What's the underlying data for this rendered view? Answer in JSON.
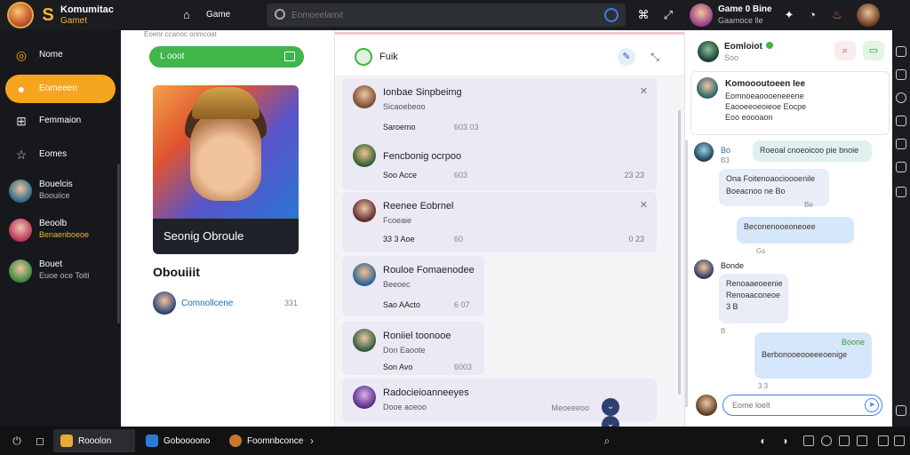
{
  "topbar": {
    "app_title": "Komumitac",
    "app_sub": "Gamet",
    "game_label": "Game",
    "search_placeholder": "Eomoeelamit",
    "profile_name": "Game 0 Bine",
    "profile_sub": "Gaamoce lle"
  },
  "sidebar": {
    "nav": [
      {
        "label": "Nome",
        "icon": "home-icon"
      },
      {
        "label": "Eomeeen",
        "icon": "friends-icon"
      },
      {
        "label": "Femmaion",
        "icon": "grid-icon"
      },
      {
        "label": "Eomes",
        "icon": "star-icon"
      }
    ],
    "contacts": [
      {
        "name": "Bouelcis",
        "sub": "Boouiice"
      },
      {
        "name": "Beoolb",
        "sub": "Benaenboeoe"
      },
      {
        "name": "Bouet",
        "sub": "Euoe oce Toiti"
      }
    ]
  },
  "game_panel": {
    "caption": "Eoenr ccanoc onmcoat",
    "green_button": "L ooot",
    "hero_title": "Seonig Obroule",
    "section_title": "Obouiiit",
    "item_label": "Comnollcene",
    "item_meta": "331"
  },
  "feed": {
    "title": "Fuik",
    "items": [
      {
        "name": "Ionbae Sinpbeimg",
        "sub": "Sicaoebeoo",
        "user": "Saroemo",
        "count": "",
        "meta": "",
        "mid": "603 03",
        "closable": true
      },
      {
        "name": "Fencbonig ocrpoo",
        "sub": "",
        "user": "Soo Acce",
        "count": "603",
        "meta": "23 23",
        "closable": false
      },
      {
        "name": "Reenee Eobrnel",
        "sub": "Fcoeaie",
        "user": "33 3 Aoe",
        "count": "60",
        "meta": "0 23",
        "closable": true
      },
      {
        "name": "Rouloe Fomaenodee",
        "sub": "Beeoec",
        "user": "Sao AActo",
        "count": "6 07",
        "meta": "",
        "closable": false
      },
      {
        "name": "Roniiel toonooe",
        "sub": "Don Eaoote",
        "user": "Son Avo",
        "count": "6003",
        "meta": "",
        "closable": false
      },
      {
        "name": "Radocieioanneeyes",
        "sub": "Dooe aoeoo",
        "user": "",
        "count": "",
        "meta": "Meoeeeoo",
        "closable": false
      }
    ]
  },
  "chat": {
    "header_name": "Eomloiot",
    "header_sub": "Soo",
    "pinned": {
      "name": "Komoooutoeen Iee",
      "lines": [
        "Eomnoeaoooeneeene",
        "Eaooeeoeoieoe Eocpe",
        "Eoo eoooaon"
      ]
    },
    "messages": [
      {
        "sender": "Bo",
        "lines": [
          "Roeoal cnoeoicoo pie bnoie"
        ],
        "time": "B3",
        "dir": "in"
      },
      {
        "sender": "",
        "lines": [
          "Ona Foitenoaocioooenile",
          "Boeacnoo ne Bo"
        ],
        "time": "Be",
        "dir": "out"
      },
      {
        "sender": "",
        "lines": [
          "Beconenooeoneoee"
        ],
        "time": "Gs",
        "dir": "out"
      },
      {
        "sender": "Bonde",
        "lines": [
          "Renoaaeoeenie",
          "Renoaaconeoe",
          "3 B"
        ],
        "time": "B",
        "dir": "in"
      },
      {
        "sender": "Boone",
        "lines": [
          "Berbonooeooeeeoenige"
        ],
        "time": "3 3",
        "dir": "out"
      }
    ],
    "input_placeholder": "Eome loelt"
  },
  "taskbar": {
    "apps": [
      {
        "label": "Rooolon",
        "color": "#e9a93a"
      },
      {
        "label": "Goboooono",
        "color": "#2b7bd6"
      },
      {
        "label": "Foomnbconce",
        "color": "#c9772f"
      }
    ]
  }
}
